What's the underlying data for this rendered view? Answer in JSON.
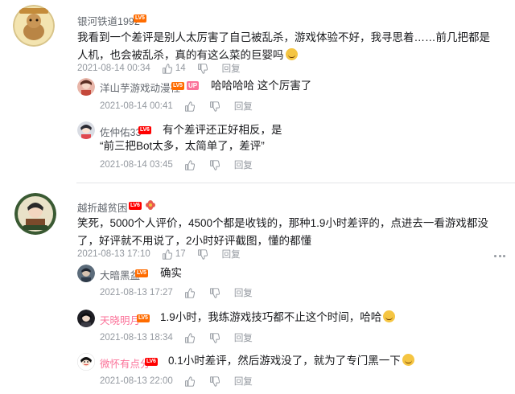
{
  "comments": [
    {
      "username": "银河铁道1992",
      "level": "LV5",
      "text": "我看到一个差评是别人太厉害了自己被乱杀，游戏体验不好，我寻思着……前几把都是人机，也会被乱杀，真的有这么菜的巨婴吗",
      "time": "2021-08-14 00:34",
      "likes": "14",
      "reply_label": "回复",
      "replies": [
        {
          "username": "洋山芋游戏动漫社",
          "level": "LV5",
          "badge": "UP",
          "text": "哈哈哈哈 这个厉害了",
          "time": "2021-08-14 00:41",
          "reply_label": "回复"
        },
        {
          "username": "佐仲佑33",
          "level": "LV6",
          "text_line1": "有个差评还正好相反，是",
          "text_line2": "“前三把Bot太多，太简单了，差评”",
          "time": "2021-08-14 03:45",
          "reply_label": "回复"
        }
      ]
    },
    {
      "username": "越折越贫困",
      "level": "LV6",
      "text": "笑死，5000个人评价，4500个都是收钱的，那种1.9小时差评的，点进去一看游戏都没了，好评就不用说了，2小时好评截图，懂的都懂",
      "time": "2021-08-13 17:10",
      "likes": "17",
      "reply_label": "回复",
      "replies": [
        {
          "username": "大暗黑盆",
          "level": "LV5",
          "text": "确实",
          "time": "2021-08-13 17:27",
          "reply_label": "回复"
        },
        {
          "username": "天晓明月",
          "level": "LV5",
          "text": "1.9小时，我练游戏技巧都不止这个时间，哈哈",
          "time": "2021-08-13 18:34",
          "reply_label": "回复"
        },
        {
          "username": "微怀有点分",
          "level": "LV6",
          "text": "0.1小时差评，然后游戏没了，就为了专门黑一下",
          "time": "2021-08-13 22:00",
          "reply_label": "回复"
        }
      ]
    }
  ],
  "icons": {
    "like": "thumb-up-icon",
    "dislike": "thumb-down-icon",
    "more": "more-dots-icon"
  },
  "colors": {
    "username_vip": "#fb7299",
    "meta": "#9499a0",
    "level_lv5": "#ff6c00",
    "level_lv6": "#ff0000",
    "up_badge": "#fb7299"
  }
}
